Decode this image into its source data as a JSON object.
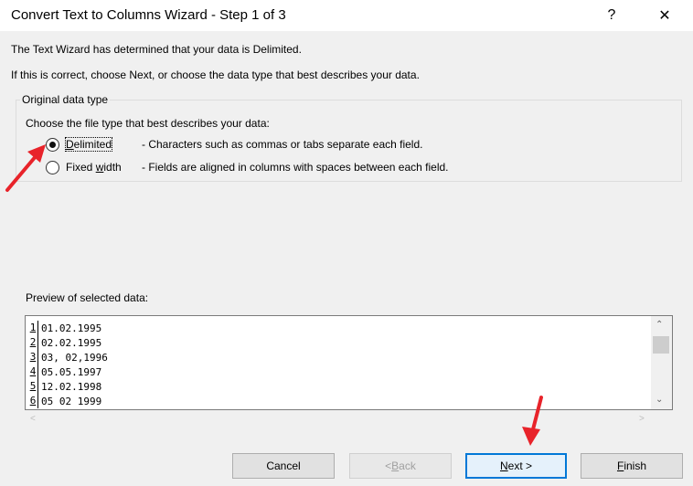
{
  "window": {
    "title": "Convert Text to Columns Wizard - Step 1 of 3",
    "help_glyph": "?",
    "close_glyph": "✕"
  },
  "info": {
    "line1": "The Text Wizard has determined that your data is Delimited.",
    "line2": "If this is correct, choose Next, or choose the data type that best describes your data."
  },
  "original_data_type": {
    "group_title": "Original data type",
    "prompt": "Choose the file type that best describes your data:",
    "options": [
      {
        "label_hot": "D",
        "label_rest": "elimited",
        "description": "- Characters such as commas or tabs separate each field.",
        "selected": true
      },
      {
        "label_pre": "Fixed ",
        "label_hot": "w",
        "label_rest": "idth",
        "description": "- Fields are aligned in columns with spaces between each field.",
        "selected": false
      }
    ]
  },
  "preview": {
    "label": "Preview of selected data:",
    "rows": [
      {
        "num": "1",
        "text": "01.02.1995"
      },
      {
        "num": "2",
        "text": "02.02.1995"
      },
      {
        "num": "3",
        "text": "03, 02,1996"
      },
      {
        "num": "4",
        "text": "05.05.1997"
      },
      {
        "num": "5",
        "text": "12.02.1998"
      },
      {
        "num": "6",
        "text": "05 02 1999"
      }
    ],
    "scroll_up_glyph": "⌃",
    "scroll_down_glyph": "⌄",
    "scroll_left_glyph": "<",
    "scroll_right_glyph": ">"
  },
  "buttons": {
    "cancel": "Cancel",
    "back_hot": "B",
    "back_pre": "< ",
    "back_rest": "ack",
    "next_hot": "N",
    "next_rest": "ext >",
    "finish_hot": "F",
    "finish_rest": "inish"
  },
  "colors": {
    "annotation_arrow": "#e8232a",
    "default_button_border": "#0078d7"
  }
}
